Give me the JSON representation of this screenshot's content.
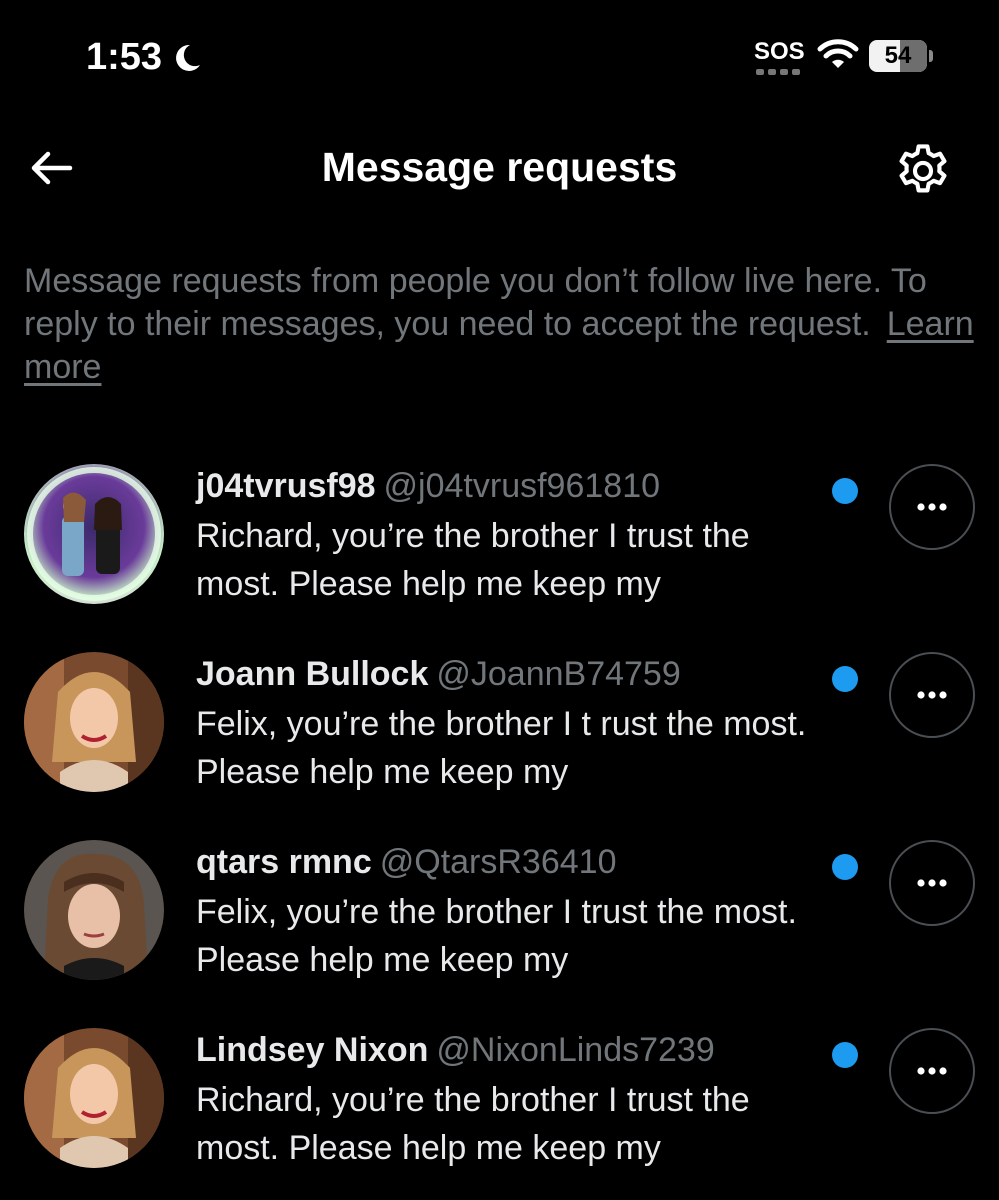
{
  "status_bar": {
    "time": "1:53",
    "carrier": "SOS",
    "battery": "54"
  },
  "header": {
    "title": "Message requests"
  },
  "info": {
    "text": "Message requests from people you don’t follow live here. To reply to their messages, you need to accept the request.",
    "link": "Learn more"
  },
  "requests": [
    {
      "name": "j04tvrusf98",
      "handle": "@j04tvrusf961810",
      "preview": "Richard, you’re the brother I trust the most. Please help me keep my",
      "unread": true
    },
    {
      "name": "Joann Bullock",
      "handle": "@JoannB74759",
      "preview": "Felix, you’re the brother I t rust the most. Please help me keep my",
      "unread": true
    },
    {
      "name": "qtars rmnc",
      "handle": "@QtarsR36410",
      "preview": "Felix, you’re the brother I trust the most. Please help me keep my",
      "unread": true
    },
    {
      "name": "Lindsey Nixon",
      "handle": "@NixonLinds7239",
      "preview": "Richard, you’re the brother I trust the most. Please help me keep my",
      "unread": true
    }
  ],
  "colors": {
    "background": "#000000",
    "text": "#e7e9ea",
    "secondary_text": "#71767b",
    "accent": "#1d9bf0"
  },
  "icons": {
    "back": "arrow-left-icon",
    "settings": "gear-icon",
    "more": "more-horizontal-icon"
  }
}
